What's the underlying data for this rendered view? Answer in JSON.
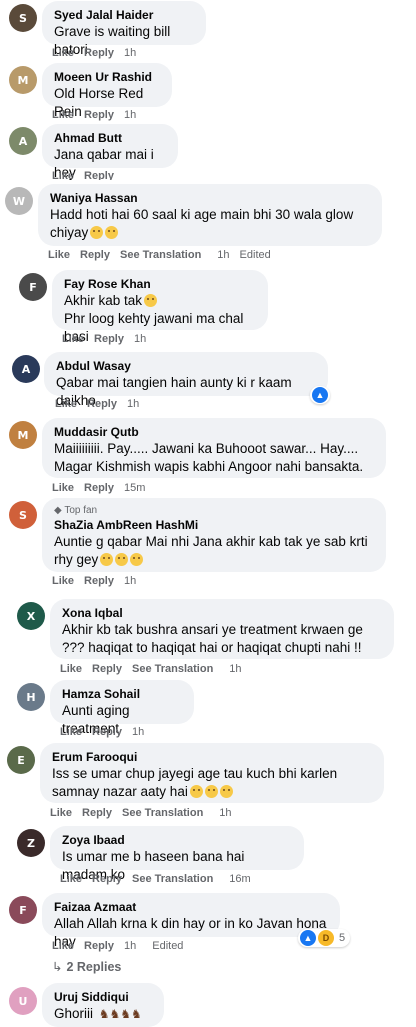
{
  "comments": [
    {
      "name": "Syed Jalal Haider",
      "text": "Grave is waiting bill batori",
      "like": "Like",
      "reply": "Reply",
      "time": "1h",
      "avatar_color": "#5a4a3a"
    },
    {
      "name": "Moeen Ur Rashid",
      "text": "Old Horse Red Rein",
      "like": "Like",
      "reply": "Reply",
      "time": "1h",
      "avatar_color": "#b89a6a"
    },
    {
      "name": "Ahmad Butt",
      "text": "Jana qabar mai i hey",
      "like": "Like",
      "reply": "Reply",
      "time": "",
      "avatar_color": "#7d8a6a"
    },
    {
      "name": "Waniya Hassan",
      "text": "Hadd hoti hai 60 saal ki age main bhi 30 wala glow chiyay",
      "like": "Like",
      "reply": "Reply",
      "see_translation": "See Translation",
      "time": "1h",
      "edited": "Edited",
      "avatar_color": "#b8b8b8"
    },
    {
      "name": "Fay Rose Khan",
      "text": "Akhir kab tak",
      "text2": "Phr loog kehty jawani ma chal basi",
      "like": "Like",
      "reply": "Reply",
      "time": "1h",
      "avatar_color": "#4a4a4a"
    },
    {
      "name": "Abdul Wasay",
      "text": "Qabar mai tangien hain aunty ki r kaam daikho",
      "like": "Like",
      "reply": "Reply",
      "time": "1h",
      "avatar_color": "#2a3a5a"
    },
    {
      "name": "Muddasir Qutb",
      "text": "Maiiiiiiiii. Pay..... Jawani ka Buhooot sawar... Hay.... Magar Kishmish wapis kabhi Angoor nahi bansakta.",
      "like": "Like",
      "reply": "Reply",
      "time": "15m",
      "avatar_color": "#c08040"
    },
    {
      "name": "ShaZia AmbReen HashMi",
      "badge": "Top fan",
      "text": "Auntie g qabar Mai nhi Jana akhir kab tak ye sab krti rhy gey",
      "like": "Like",
      "reply": "Reply",
      "time": "1h",
      "avatar_color": "#d0603a"
    },
    {
      "name": "Xona Iqbal",
      "text": "Akhir kb tak bushra ansari ye treatment krwaen ge ??? haqiqat to haqiqat hai or haqiqat chupti nahi !!",
      "like": "Like",
      "reply": "Reply",
      "see_translation": "See Translation",
      "time": "1h",
      "avatar_color": "#1f5a4a"
    },
    {
      "name": "Hamza Sohail",
      "text": "Aunti aging treatment",
      "like": "Like",
      "reply": "Reply",
      "time": "1h",
      "avatar_color": "#6a7a8a"
    },
    {
      "name": "Erum Farooqui",
      "text": "Iss se umar chup jayegi age tau kuch bhi karlen samnay nazar aaty hai",
      "like": "Like",
      "reply": "Reply",
      "see_translation": "See Translation",
      "time": "1h",
      "avatar_color": "#5a6a4a"
    },
    {
      "name": "Zoya Ibaad",
      "text": "Is umar me b haseen bana hai madam ko",
      "like": "Like",
      "reply": "Reply",
      "see_translation": "See Translation",
      "time": "16m",
      "avatar_color": "#3a2a2a"
    },
    {
      "name": "Faizaa Azmaat",
      "text": "Allah Allah krna k din hay or in ko Javan hona hay",
      "like": "Like",
      "reply": "Reply",
      "time": "1h",
      "edited": "Edited",
      "reaction_count": "5",
      "avatar_color": "#8a4a5a"
    },
    {
      "name": "Uruj Siddiqui",
      "text": "Ghoriii",
      "avatar_color": "#e0a0c0"
    }
  ],
  "replies_link": "2 Replies",
  "colors": {
    "bubble": "#f0f2f5",
    "meta": "#65676b",
    "accent": "#1877f2"
  }
}
